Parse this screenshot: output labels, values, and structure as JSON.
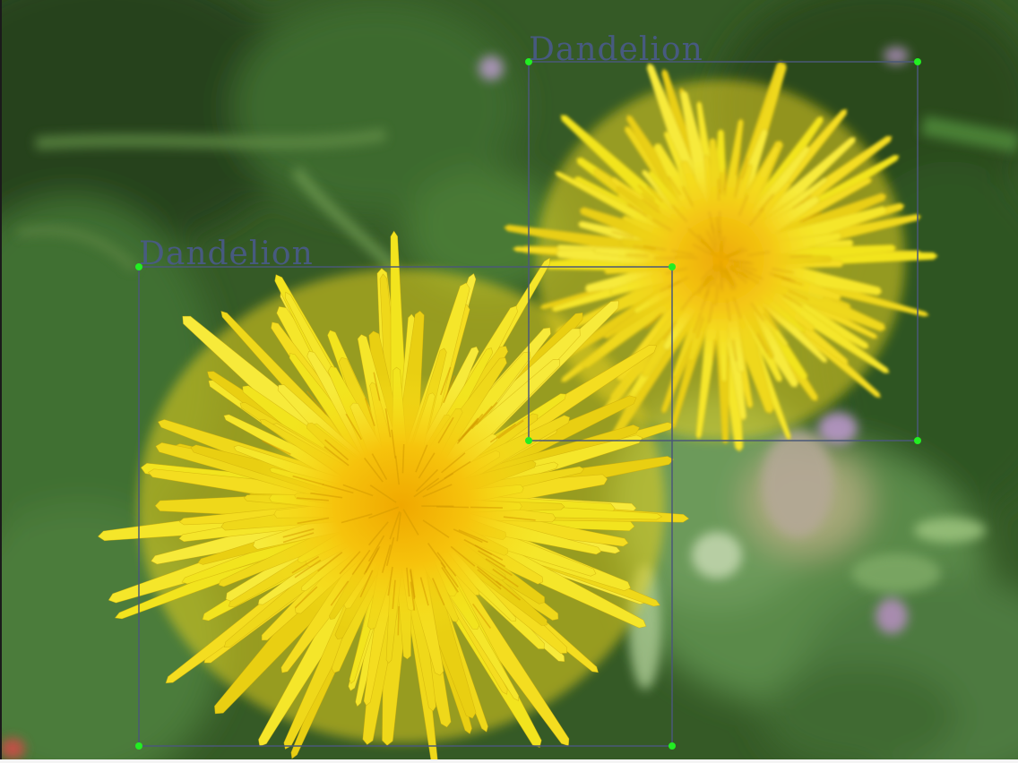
{
  "annotation_color": "#4a5878",
  "corner_color": "#22ee22",
  "detections": [
    {
      "label": "Dandelion"
    },
    {
      "label": "Dandelion"
    }
  ]
}
